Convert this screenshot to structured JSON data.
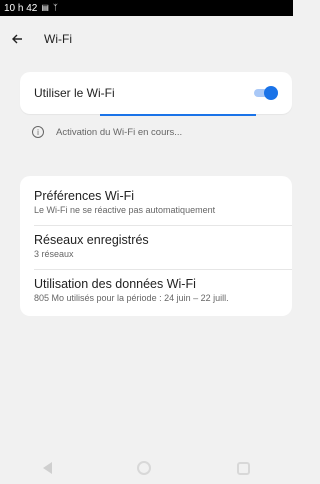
{
  "status_bar": {
    "time": "10 h 42",
    "icons": [
      "message-icon",
      "network-icon"
    ]
  },
  "toolbar": {
    "title": "Wi-Fi",
    "back_icon": "back-arrow-icon"
  },
  "wifi_toggle": {
    "label": "Utiliser le Wi-Fi",
    "enabled": true,
    "accent": "#1a73e8"
  },
  "info": {
    "text": "Activation du Wi-Fi en cours..."
  },
  "items": [
    {
      "title": "Préférences Wi-Fi",
      "subtitle": "Le Wi-Fi ne se réactive pas automatiquement"
    },
    {
      "title": "Réseaux enregistrés",
      "subtitle": "3 réseaux"
    },
    {
      "title": "Utilisation des données Wi-Fi",
      "subtitle": "805 Mo utilisés pour la période : 24 juin – 22 juill."
    }
  ],
  "nav": {
    "icons": [
      "back-triangle-icon",
      "home-circle-icon",
      "recents-square-icon"
    ]
  }
}
